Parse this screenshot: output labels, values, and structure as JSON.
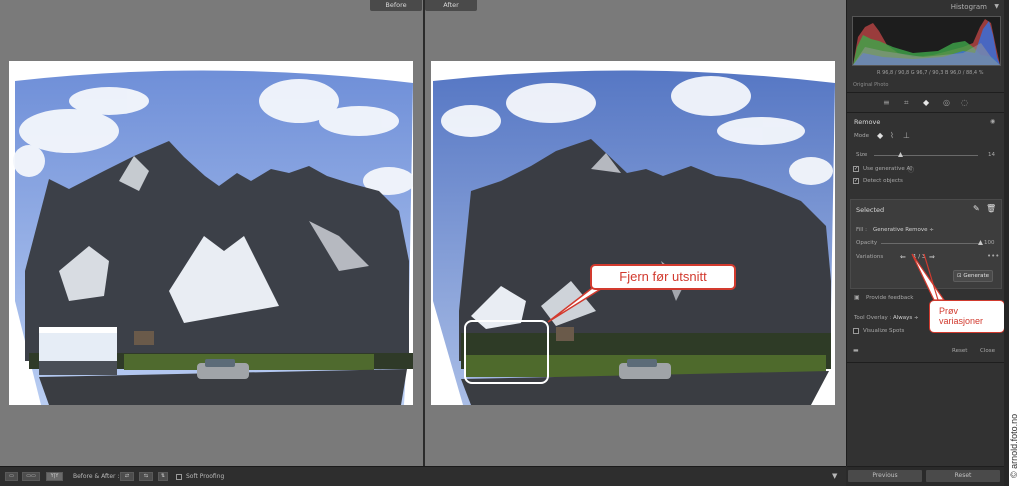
{
  "compare": {
    "before_label": "Before",
    "after_label": "After"
  },
  "callouts": {
    "remove_before_crop": "Fjern før utsnitt",
    "try_variations": "Prøv variasjoner"
  },
  "panel": {
    "histogram_title": "Histogram",
    "histogram_readout": "R 96,8 / 90,8   G 96,7 / 90,3   B 96,0 / 88,4 %",
    "original_photo": "Original Photo",
    "remove_title": "Remove",
    "mode_label": "Mode",
    "size_label": "Size",
    "size_value": "14",
    "size_level": 0.25,
    "use_generative_ai": "Use generative AI",
    "use_generative_ai_checked": true,
    "detect_objects": "Detect objects",
    "detect_objects_checked": true,
    "selected_title": "Selected",
    "fill_label": "Fill :",
    "fill_value": "Generative Remove ÷",
    "opacity_label": "Opacity",
    "opacity_value": "100",
    "opacity_level": 1.0,
    "variations_label": "Variations",
    "variations_value": "1 / 3",
    "generate_label": "Generate",
    "provide_feedback": "Provide feedback",
    "tool_overlay_label": "Tool Overlay :",
    "tool_overlay_value": "Always ÷",
    "visualize_spots": "Visualize Spots",
    "reset_label": "Reset",
    "close_label": "Close",
    "previous_label": "Previous",
    "reset_all_label": "Reset"
  },
  "toolbar": {
    "before_after_label": "Before & After :",
    "soft_proofing": "Soft Proofing",
    "yy_label": "Y|Y"
  },
  "watermark": "© arnold.foto.no",
  "colors": {
    "callout_red": "#d23a2e",
    "panel_bg": "#323232",
    "canvas_bg": "#7a7a7a"
  }
}
